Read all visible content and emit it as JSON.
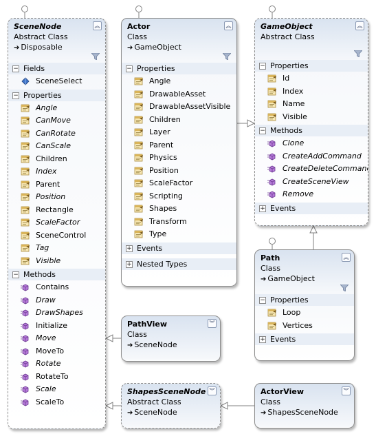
{
  "classes": {
    "scenenode": {
      "name": "SceneNode",
      "kind": "Abstract Class",
      "base": "Disposable",
      "fields": {
        "label": "Fields",
        "items": [
          {
            "name": "SceneSelect",
            "italic": false
          }
        ]
      },
      "properties": {
        "label": "Properties",
        "items": [
          {
            "name": "Angle",
            "italic": true
          },
          {
            "name": "CanMove",
            "italic": true
          },
          {
            "name": "CanRotate",
            "italic": true
          },
          {
            "name": "CanScale",
            "italic": true
          },
          {
            "name": "Children",
            "italic": false
          },
          {
            "name": "Index",
            "italic": true
          },
          {
            "name": "Parent",
            "italic": false
          },
          {
            "name": "Position",
            "italic": true
          },
          {
            "name": "Rectangle",
            "italic": false
          },
          {
            "name": "ScaleFactor",
            "italic": true
          },
          {
            "name": "SceneControl",
            "italic": false
          },
          {
            "name": "Tag",
            "italic": true
          },
          {
            "name": "Visible",
            "italic": true
          }
        ]
      },
      "methods": {
        "label": "Methods",
        "items": [
          {
            "name": "Contains",
            "italic": false
          },
          {
            "name": "Draw",
            "italic": true
          },
          {
            "name": "DrawShapes",
            "italic": true
          },
          {
            "name": "Initialize",
            "italic": false
          },
          {
            "name": "Move",
            "italic": true
          },
          {
            "name": "MoveTo",
            "italic": false
          },
          {
            "name": "Rotate",
            "italic": true
          },
          {
            "name": "RotateTo",
            "italic": false
          },
          {
            "name": "Scale",
            "italic": true
          },
          {
            "name": "ScaleTo",
            "italic": false
          }
        ]
      }
    },
    "actor": {
      "name": "Actor",
      "kind": "Class",
      "base": "GameObject",
      "properties": {
        "label": "Properties",
        "items": [
          {
            "name": "Angle",
            "italic": false
          },
          {
            "name": "DrawableAsset",
            "italic": false
          },
          {
            "name": "DrawableAssetVisible",
            "italic": false
          },
          {
            "name": "Children",
            "italic": false
          },
          {
            "name": "Layer",
            "italic": false
          },
          {
            "name": "Parent",
            "italic": false
          },
          {
            "name": "Physics",
            "italic": false
          },
          {
            "name": "Position",
            "italic": false
          },
          {
            "name": "ScaleFactor",
            "italic": false
          },
          {
            "name": "Scripting",
            "italic": false
          },
          {
            "name": "Shapes",
            "italic": false
          },
          {
            "name": "Transform",
            "italic": false
          },
          {
            "name": "Type",
            "italic": false
          }
        ]
      },
      "events": {
        "label": "Events"
      },
      "nested": {
        "label": "Nested Types"
      }
    },
    "gameobject": {
      "name": "GameObject",
      "kind": "Abstract Class",
      "properties": {
        "label": "Properties",
        "items": [
          {
            "name": "Id",
            "italic": false
          },
          {
            "name": "Index",
            "italic": false
          },
          {
            "name": "Name",
            "italic": false
          },
          {
            "name": "Visible",
            "italic": false
          }
        ]
      },
      "methods": {
        "label": "Methods",
        "items": [
          {
            "name": "Clone",
            "italic": true
          },
          {
            "name": "CreateAddCommand",
            "italic": true
          },
          {
            "name": "CreateDeleteCommand",
            "italic": true
          },
          {
            "name": "CreateSceneView",
            "italic": true
          },
          {
            "name": "Remove",
            "italic": true
          }
        ]
      },
      "events": {
        "label": "Events"
      }
    },
    "path": {
      "name": "Path",
      "kind": "Class",
      "base": "GameObject",
      "properties": {
        "label": "Properties",
        "items": [
          {
            "name": "Loop",
            "italic": false
          },
          {
            "name": "Vertices",
            "italic": false
          }
        ]
      },
      "events": {
        "label": "Events"
      }
    },
    "pathview": {
      "name": "PathView",
      "kind": "Class",
      "base": "SceneNode"
    },
    "shapesscenenode": {
      "name": "ShapesSceneNode",
      "kind": "Abstract Class",
      "base": "SceneNode"
    },
    "actorview": {
      "name": "ActorView",
      "kind": "Class",
      "base": "ShapesSceneNode"
    }
  },
  "glyphs": {
    "collapse_up": "︽",
    "expand_down": "︾",
    "minus": "−",
    "plus": "+",
    "inherit_arrow": "➔"
  },
  "colors": {
    "header_gradient": "#d9e3f0",
    "border": "#8c8c8c",
    "section_band": "#e8eef6",
    "method_icon": "#9b59c9",
    "field_icon": "#2f5fb3",
    "property_icon": "#d4a640"
  }
}
